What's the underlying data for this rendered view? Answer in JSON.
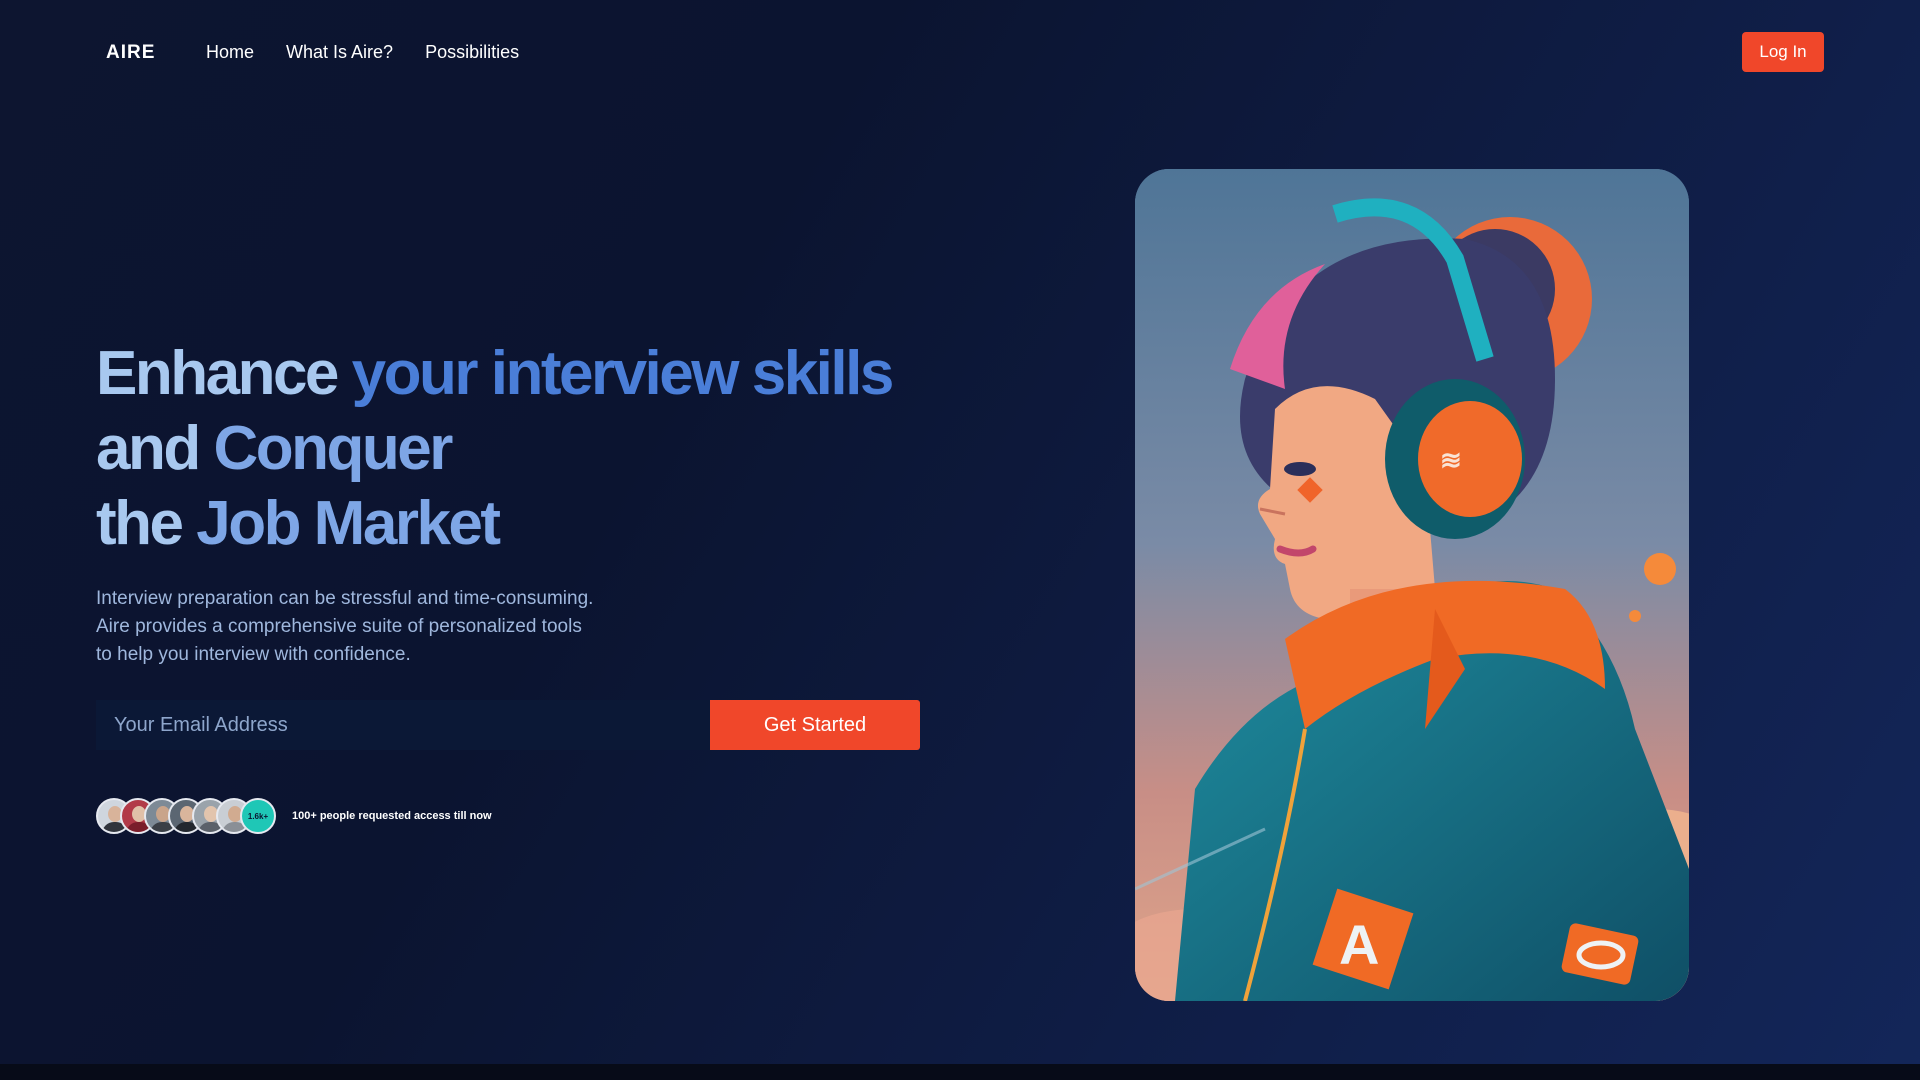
{
  "nav": {
    "logo": "AIRE",
    "links": [
      "Home",
      "What Is Aire?",
      "Possibilities"
    ],
    "login_label": "Log In"
  },
  "hero": {
    "headline": {
      "line1_a": "Enhance ",
      "line1_b": "your interview skills",
      "line2_a": "and ",
      "line2_b": "Conquer",
      "line3_a": "the ",
      "line3_b": "Job Market"
    },
    "description": [
      "Interview preparation can be stressful and time-consuming.",
      "Aire provides a comprehensive suite of personalized tools",
      "to help you interview with confidence."
    ],
    "email_placeholder": "Your Email Address",
    "cta_label": "Get Started",
    "social_count_badge": "1.6k+",
    "social_text": "100+ people requested access till now"
  },
  "colors": {
    "accent": "#f0472a",
    "headline_light": "#a8c8ef",
    "headline_blue": "#4a7ed8",
    "background": "#0d1530",
    "teal_badge": "#1fc7b6"
  },
  "hero_image": {
    "badge_letter": "A"
  }
}
